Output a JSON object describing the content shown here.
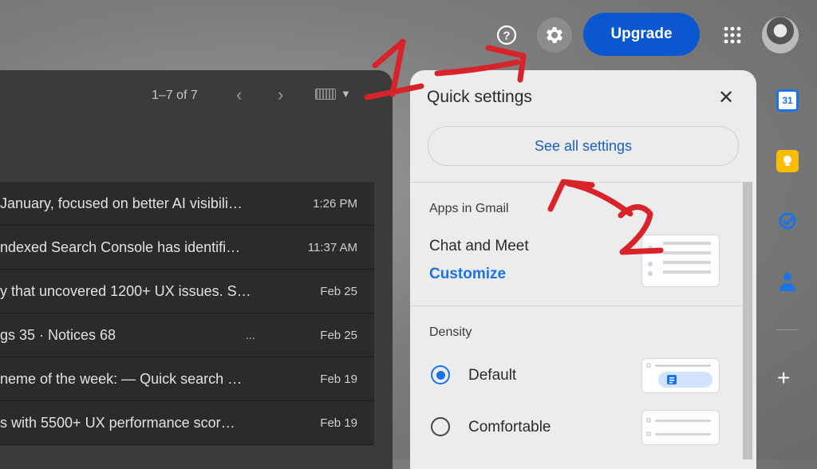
{
  "topbar": {
    "upgrade_label": "Upgrade"
  },
  "mail": {
    "pager": "1–7 of 7",
    "rows": [
      {
        "subject": "January, focused on better AI visibili…",
        "time": "1:26 PM"
      },
      {
        "subject": "ndexed Search Console has identifi…",
        "time": "11:37 AM"
      },
      {
        "subject": "y that uncovered 1200+ UX issues. S…",
        "time": "Feb 25"
      },
      {
        "subject": "gs 35 · Notices 68",
        "time": "Feb 25"
      },
      {
        "subject": "neme of the week: — Quick search …",
        "time": "Feb 19"
      },
      {
        "subject": "s with 5500+ UX performance scor…",
        "time": "Feb 19"
      }
    ]
  },
  "quick_settings": {
    "title": "Quick settings",
    "see_all": "See all settings",
    "apps_header": "Apps in Gmail",
    "chat_meet": "Chat and Meet",
    "customize": "Customize",
    "density_header": "Density",
    "density_options": [
      "Default",
      "Comfortable"
    ],
    "selected_density": "Default"
  },
  "side_panel": {
    "calendar_day": "31"
  },
  "annotations": {
    "label_1": "1",
    "label_2": "2",
    "color": "#d8232a"
  },
  "colors": {
    "accent": "#0b57d0",
    "link": "#1a73e8"
  }
}
